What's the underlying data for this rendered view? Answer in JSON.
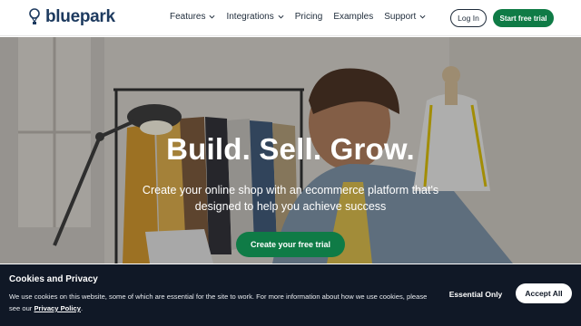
{
  "brand": {
    "name": "bluepark",
    "logo_icon": "balloon-logo-icon",
    "color": "#1d3a5f"
  },
  "nav": {
    "items": [
      {
        "label": "Features",
        "has_dropdown": true
      },
      {
        "label": "Integrations",
        "has_dropdown": true
      },
      {
        "label": "Pricing",
        "has_dropdown": false
      },
      {
        "label": "Examples",
        "has_dropdown": false
      },
      {
        "label": "Support",
        "has_dropdown": true
      }
    ],
    "login_label": "Log In",
    "trial_label": "Start free trial"
  },
  "hero": {
    "title": "Build. Sell. Grow.",
    "subtitle": "Create your online shop with an ecommerce platform that's designed to help you achieve success",
    "cta_label": "Create your free trial"
  },
  "cookie_banner": {
    "title": "Cookies and Privacy",
    "text": "We use cookies on this website, some of which are essential for the site to work. For more information about how we use cookies, please see our",
    "link_label": "Privacy Policy",
    "text_end": ".",
    "essential_label": "Essential Only",
    "accept_label": "Accept All"
  },
  "colors": {
    "accent_green": "#0f7b46",
    "cookie_bg": "#101826",
    "text_dark": "#1e2b3a"
  }
}
